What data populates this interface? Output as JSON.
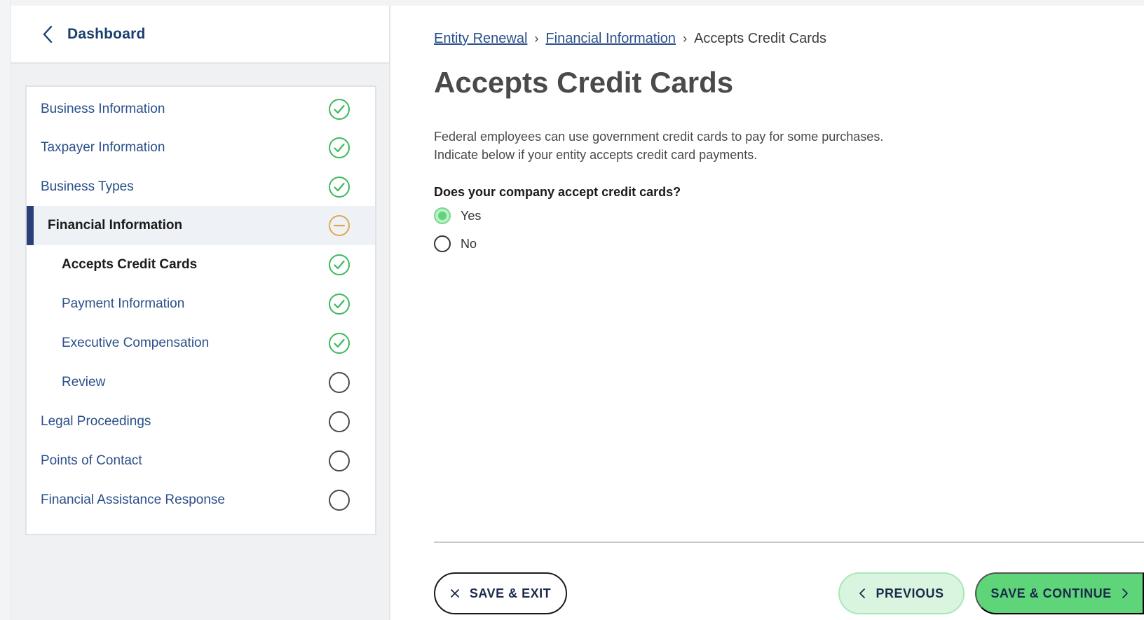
{
  "sidebar": {
    "back_label": "Dashboard",
    "items": [
      {
        "label": "Business Information",
        "level": 1,
        "status": "complete"
      },
      {
        "label": "Taxpayer Information",
        "level": 1,
        "status": "complete"
      },
      {
        "label": "Business Types",
        "level": 1,
        "status": "complete"
      },
      {
        "label": "Financial Information",
        "level": 1,
        "status": "in-progress"
      },
      {
        "label": "Accepts Credit Cards",
        "level": 2,
        "status": "complete"
      },
      {
        "label": "Payment Information",
        "level": 2,
        "status": "complete"
      },
      {
        "label": "Executive Compensation",
        "level": 2,
        "status": "complete"
      },
      {
        "label": "Review",
        "level": 2,
        "status": "not-started"
      },
      {
        "label": "Legal Proceedings",
        "level": 1,
        "status": "not-started"
      },
      {
        "label": "Points of Contact",
        "level": 1,
        "status": "not-started"
      },
      {
        "label": "Financial Assistance Response",
        "level": 1,
        "status": "not-started"
      }
    ]
  },
  "breadcrumb": {
    "items": [
      "Entity Renewal",
      "Financial Information",
      "Accepts Credit Cards"
    ]
  },
  "main": {
    "title": "Accepts Credit Cards",
    "description_line1": "Federal employees can use government credit cards to pay for some purchases.",
    "description_line2": "Indicate below if your entity accepts credit card payments.",
    "question": "Does your company accept credit cards?",
    "options": [
      {
        "label": "Yes",
        "selected": true
      },
      {
        "label": "No",
        "selected": false
      }
    ]
  },
  "footer": {
    "save_exit_label": "SAVE & EXIT",
    "previous_label": "PREVIOUS",
    "save_continue_label": "SAVE & CONTINUE"
  },
  "colors": {
    "complete": "#3cb95a",
    "in_progress": "#e0a84a",
    "not_started": "#4a4a4a",
    "primary_green": "#5fd57a",
    "nav_text": "#2a4f8a"
  }
}
